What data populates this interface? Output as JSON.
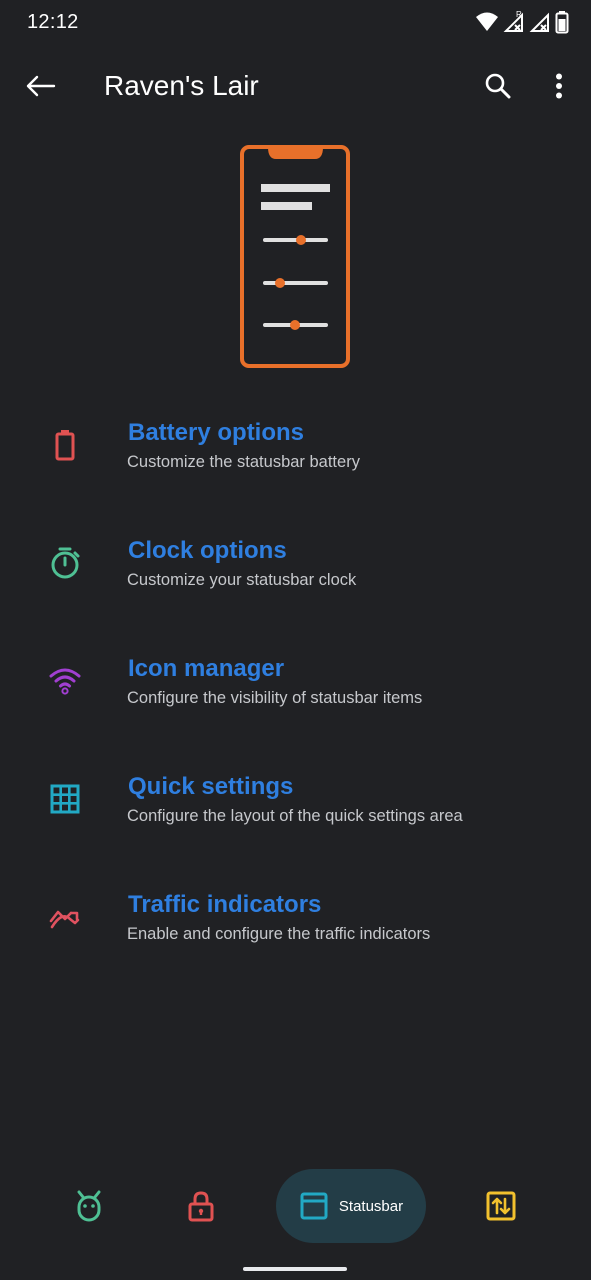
{
  "status_bar": {
    "time": "12:12",
    "roaming_label": "R"
  },
  "app_bar": {
    "title": "Raven's Lair"
  },
  "colors": {
    "accent": "#2f7fe0",
    "illustration": "#e8702a",
    "battery_icon": "#e05252",
    "clock_icon": "#4fc094",
    "icon_manager_icon": "#a13fd1",
    "quick_settings_icon": "#22a9c4",
    "traffic_icon": "#e05260",
    "nav_active_bg": "#233d47"
  },
  "settings": [
    {
      "title": "Battery options",
      "subtitle": "Customize the statusbar battery",
      "icon": "battery-icon"
    },
    {
      "title": "Clock options",
      "subtitle": "Customize your statusbar clock",
      "icon": "stopwatch-icon"
    },
    {
      "title": "Icon manager",
      "subtitle": "Configure the visibility of statusbar items",
      "icon": "wifi-icon"
    },
    {
      "title": "Quick settings",
      "subtitle": "Configure the layout of the quick settings area",
      "icon": "grid-icon"
    },
    {
      "title": "Traffic indicators",
      "subtitle": "Enable and configure the traffic indicators",
      "icon": "traffic-chart-icon"
    }
  ],
  "bottom_nav": {
    "items": [
      {
        "icon": "android-head-icon"
      },
      {
        "icon": "lock-icon"
      },
      {
        "icon": "window-icon",
        "label": "Statusbar",
        "active": true
      },
      {
        "icon": "swap-arrows-icon"
      }
    ]
  }
}
